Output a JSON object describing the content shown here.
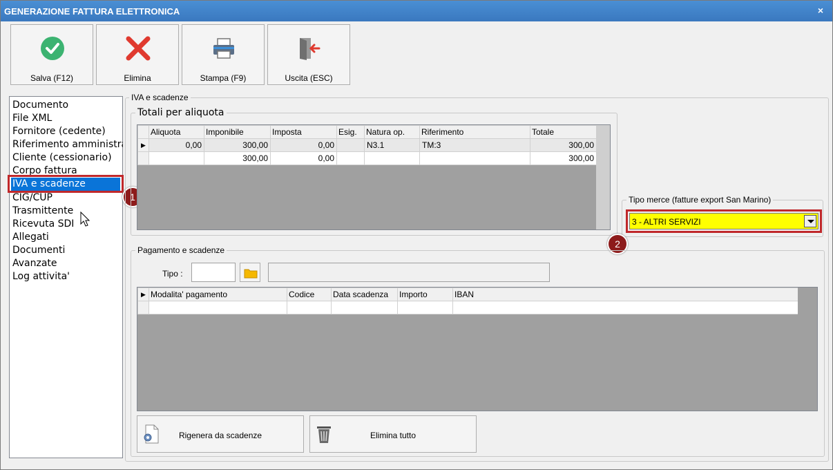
{
  "window": {
    "title": "GENERAZIONE FATTURA ELETTRONICA",
    "close_glyph": "×"
  },
  "toolbar": {
    "save_label": "Salva (F12)",
    "delete_label": "Elimina",
    "print_label": "Stampa (F9)",
    "exit_label": "Uscita (ESC)",
    "icons": [
      "check-circle-icon",
      "red-x-icon",
      "printer-icon",
      "exit-door-icon"
    ]
  },
  "nav": {
    "items": [
      "Documento",
      "File XML",
      "Fornitore (cedente)",
      "Riferimento amministrativo",
      "Cliente (cessionario)",
      "Corpo fattura",
      "IVA e scadenze",
      "CIG/CUP",
      "Trasmittente",
      "Ricevuta SDI",
      "Allegati",
      "Documenti",
      "Avanzate",
      "Log attivita'"
    ],
    "selected": "IVA e scadenze",
    "badge": "1"
  },
  "iva_group": {
    "title": "IVA e scadenze",
    "totali": {
      "title": "Totali per aliquota",
      "columns": [
        "Aliquota",
        "Imponibile",
        "Imposta",
        "Esig.",
        "Natura op.",
        "Riferimento",
        "Totale"
      ],
      "rows": [
        [
          "0,00",
          "300,00",
          "0,00",
          "",
          "N3.1",
          "TM:3",
          "300,00"
        ],
        [
          "",
          "300,00",
          "0,00",
          "",
          "",
          "",
          "300,00"
        ]
      ]
    },
    "tipo_merce": {
      "title": "Tipo merce (fatture export San Marino)",
      "value": "3 - ALTRI SERVIZI",
      "highlight_color": "#ffff00",
      "badge": "2"
    },
    "pagamento": {
      "title": "Pagamento e scadenze",
      "tipo_label": "Tipo :",
      "tipo_value": "",
      "folder_icon": "folder-icon",
      "columns": [
        "Modalita' pagamento",
        "Codice",
        "Data scadenza",
        "Importo",
        "IBAN"
      ],
      "rows": [
        [
          "",
          "",
          "",
          "",
          ""
        ]
      ],
      "regen_label": "Rigenera da scadenze",
      "delete_all_label": "Elimina tutto"
    }
  },
  "colors": {
    "accent": "#0a74d8",
    "title_bar": "#3a78bf",
    "highlight_box": "#c0282b",
    "badge": "#8d1b1b"
  }
}
